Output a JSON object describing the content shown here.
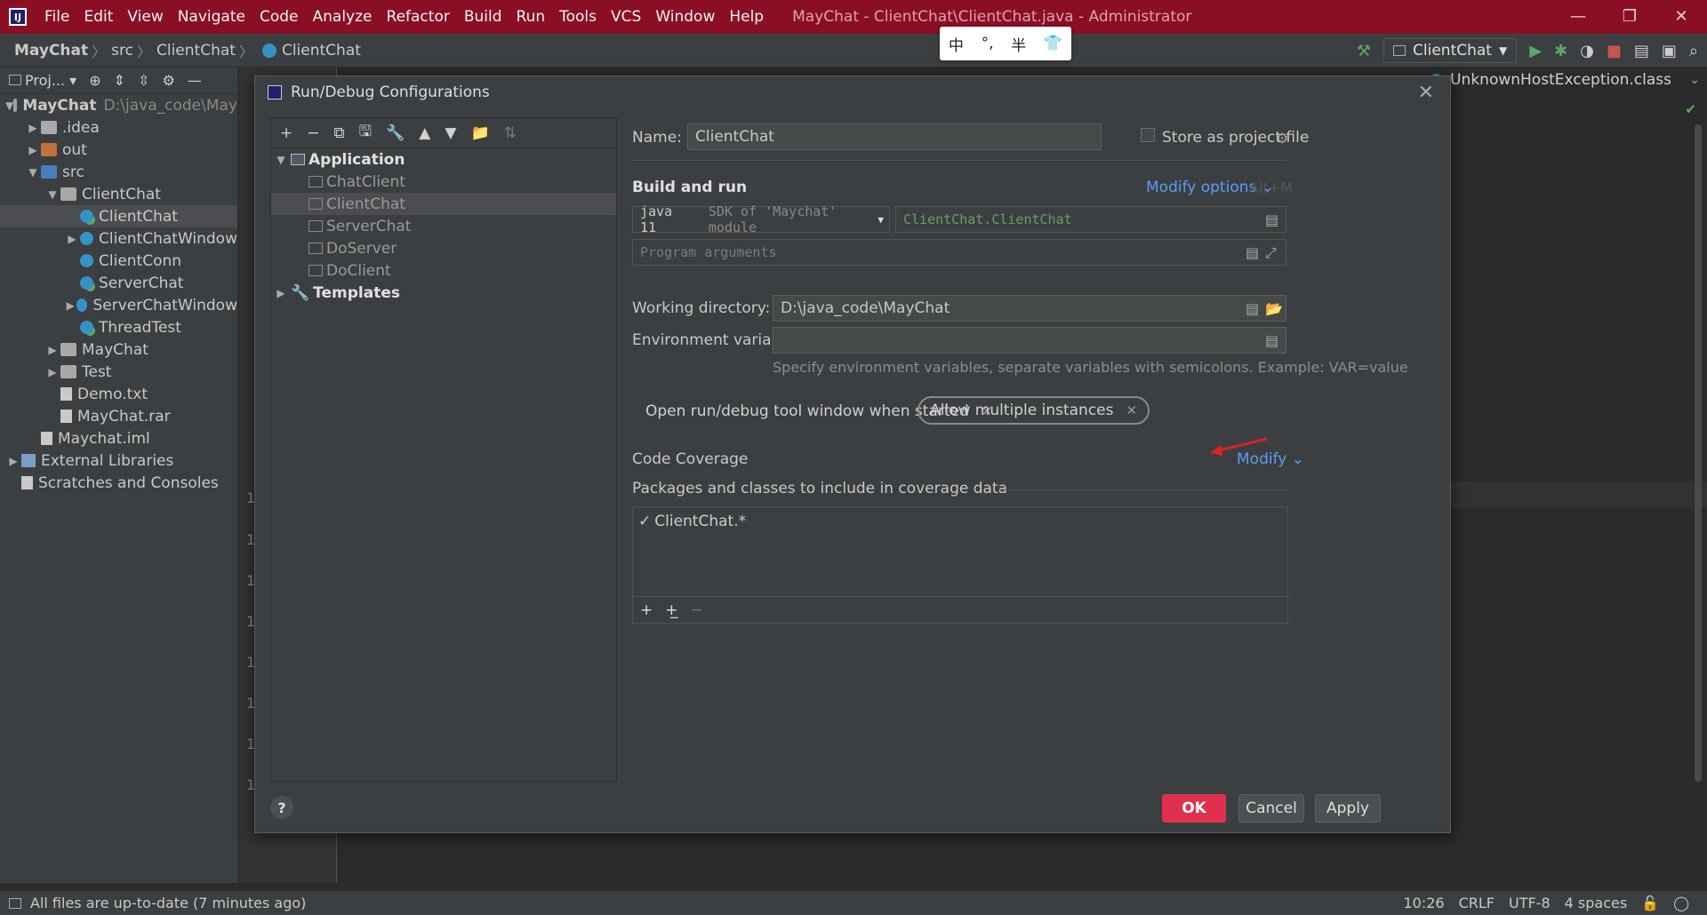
{
  "window": {
    "menu": [
      "File",
      "Edit",
      "View",
      "Navigate",
      "Code",
      "Analyze",
      "Refactor",
      "Build",
      "Run",
      "Tools",
      "VCS",
      "Window",
      "Help"
    ],
    "title": "MayChat - ClientChat\\ClientChat.java - Administrator"
  },
  "navbar": {
    "crumbs": [
      "MayChat",
      "src",
      "ClientChat",
      "ClientChat"
    ],
    "run_config": "ClientChat"
  },
  "ime": {
    "items": [
      "中",
      "°,",
      "半",
      "👕"
    ]
  },
  "project": {
    "toolbar_label": "Proj...",
    "tree": [
      {
        "label": "MayChat",
        "extra": "D:\\java_code\\May",
        "level": 0,
        "arrow": "▼",
        "icon": "folder-dark",
        "bold": true
      },
      {
        "label": ".idea",
        "level": 1,
        "arrow": "▶",
        "icon": "folder"
      },
      {
        "label": "out",
        "level": 1,
        "arrow": "▶",
        "icon": "folder-orange"
      },
      {
        "label": "src",
        "level": 1,
        "arrow": "▼",
        "icon": "folder-blue"
      },
      {
        "label": "ClientChat",
        "level": 2,
        "arrow": "▼",
        "icon": "folder"
      },
      {
        "label": "ClientChat",
        "level": 3,
        "arrow": "",
        "icon": "cls-run",
        "selected": true
      },
      {
        "label": "ClientChatWindow",
        "level": 3,
        "arrow": "▶",
        "icon": "cls"
      },
      {
        "label": "ClientConn",
        "level": 3,
        "arrow": "",
        "icon": "cls"
      },
      {
        "label": "ServerChat",
        "level": 3,
        "arrow": "",
        "icon": "cls-run"
      },
      {
        "label": "ServerChatWindow",
        "level": 3,
        "arrow": "▶",
        "icon": "cls"
      },
      {
        "label": "ThreadTest",
        "level": 3,
        "arrow": "",
        "icon": "cls-run"
      },
      {
        "label": "MayChat",
        "level": 2,
        "arrow": "▶",
        "icon": "folder"
      },
      {
        "label": "Test",
        "level": 2,
        "arrow": "▶",
        "icon": "folder"
      },
      {
        "label": "Demo.txt",
        "level": 2,
        "arrow": "",
        "icon": "file"
      },
      {
        "label": "MayChat.rar",
        "level": 2,
        "arrow": "",
        "icon": "file"
      },
      {
        "label": "Maychat.iml",
        "level": 1,
        "arrow": "",
        "icon": "file"
      },
      {
        "label": "External Libraries",
        "level": 0,
        "arrow": "▶",
        "icon": "lib"
      },
      {
        "label": "Scratches and Consoles",
        "level": 0,
        "arrow": "",
        "icon": "file"
      }
    ]
  },
  "editor": {
    "tab_right": "UnknownHostException.class",
    "gutter_digits": [
      "1",
      "1",
      "1",
      "1",
      "1",
      "1",
      "1",
      "1"
    ]
  },
  "dialog": {
    "title": "Run/Debug Configurations",
    "tree": {
      "application_label": "Application",
      "items": [
        "ChatClient",
        "ClientChat",
        "ServerChat",
        "DoServer",
        "DoClient"
      ],
      "selected_index": 1,
      "templates_label": "Templates"
    },
    "name_label": "Name:",
    "name_value": "ClientChat",
    "store_label": "Store as project file",
    "build_run_title": "Build and run",
    "modify_options": "Modify options",
    "modify_shortcut": "Alt+M",
    "sdk_value": "java 11",
    "sdk_hint": "SDK of 'Maychat' module",
    "main_class": "ClientChat.ClientChat",
    "program_args_placeholder": "Program arguments",
    "working_dir_label": "Working directory:",
    "working_dir_value": "D:\\java_code\\MayChat",
    "env_label": "Environment variables:",
    "env_value": "",
    "env_hint": "Specify environment variables, separate variables with semicolons. Example: VAR=value",
    "chips": [
      "Open run/debug tool window when started",
      "Allow multiple instances"
    ],
    "coverage_title": "Code Coverage",
    "coverage_modify": "Modify",
    "packages_label": "Packages and classes to include in coverage data",
    "coverage_entry": "ClientChat.*",
    "buttons": {
      "ok": "OK",
      "cancel": "Cancel",
      "apply": "Apply",
      "help": "?"
    }
  },
  "status": {
    "message": "All files are up-to-date (7 minutes ago)",
    "position": "10:26",
    "line_sep": "CRLF",
    "encoding": "UTF-8",
    "indent": "4 spaces"
  },
  "colors": {
    "title_bar": "#8b0f24",
    "ok_button": "#e0304e",
    "link": "#589df6",
    "annotation_arrow": "#e02020"
  }
}
